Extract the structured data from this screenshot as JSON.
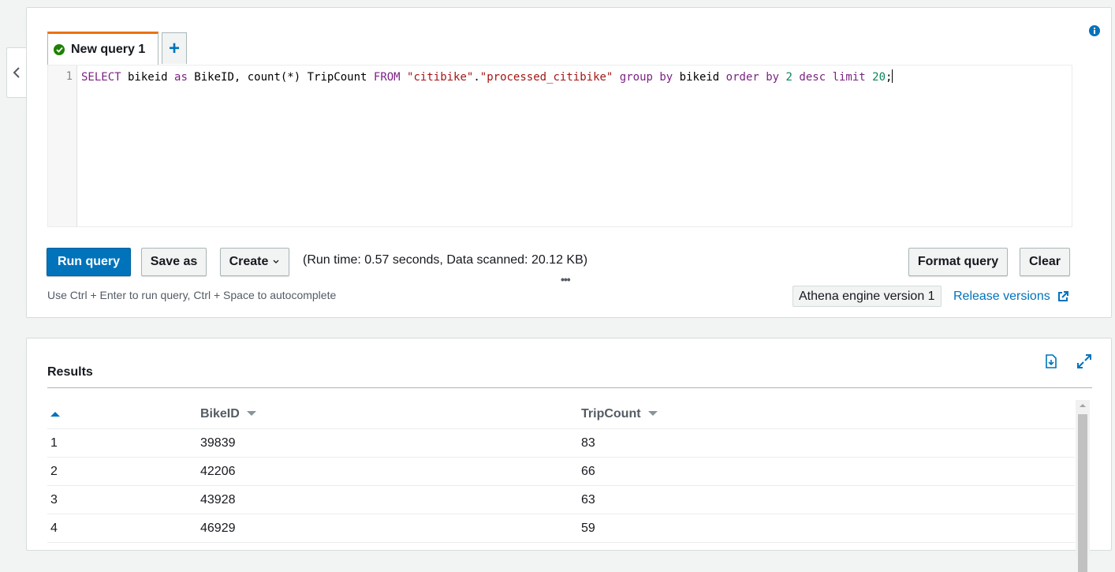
{
  "editor": {
    "tab_label": "New query 1",
    "add_tab_label": "+",
    "line_number": "1",
    "code": {
      "t1": "SELECT",
      "t2": " bikeid ",
      "t3": "as",
      "t4": " BikeID, count(*) TripCount ",
      "t5": "FROM",
      "t6": " ",
      "t7": "\"citibike\"",
      "t8": ".",
      "t9": "\"processed_citibike\"",
      "t10": " ",
      "t11": "group by",
      "t12": " bikeid ",
      "t13": "order by",
      "t14": " ",
      "t15": "2",
      "t16": " ",
      "t17": "desc",
      "t18": " ",
      "t19": "limit",
      "t20": " ",
      "t21": "20",
      "t22": ";"
    }
  },
  "toolbar": {
    "run_query": "Run query",
    "save_as": "Save as",
    "create": "Create",
    "runtime": "(Run time: 0.57 seconds, Data scanned: 20.12 KB)",
    "dots": "•••",
    "format_query": "Format query",
    "clear": "Clear",
    "hint": "Use Ctrl + Enter to run query, Ctrl + Space to autocomplete",
    "engine": "Athena engine version 1",
    "release_versions": "Release versions"
  },
  "results": {
    "title": "Results",
    "columns": [
      "BikeID",
      "TripCount"
    ],
    "rows": [
      {
        "index": "1",
        "bikeid": "39839",
        "tripcount": "83"
      },
      {
        "index": "2",
        "bikeid": "42206",
        "tripcount": "66"
      },
      {
        "index": "3",
        "bikeid": "43928",
        "tripcount": "63"
      },
      {
        "index": "4",
        "bikeid": "46929",
        "tripcount": "59"
      }
    ]
  },
  "colors": {
    "primary": "#0073bb",
    "tab_accent": "#ec7211",
    "success": "#1d8102"
  },
  "icons": [
    "chevron-left-icon",
    "check-circle-icon",
    "info-icon",
    "chevron-down-icon",
    "external-link-icon",
    "download-icon",
    "expand-icon",
    "sort-up-icon",
    "sort-down-icon"
  ]
}
